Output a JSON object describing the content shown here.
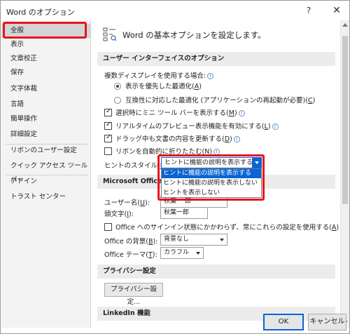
{
  "window": {
    "title": "Word のオプション",
    "help": "?",
    "close": "✕"
  },
  "sidebar": {
    "items": [
      {
        "label": "全般",
        "selected": true
      },
      {
        "label": "表示"
      },
      {
        "label": "文章校正"
      },
      {
        "label": "保存"
      },
      {
        "label": "文字体裁"
      },
      {
        "label": "言語"
      },
      {
        "label": "簡単操作"
      },
      {
        "label": "詳細設定"
      },
      {
        "label": "リボンのユーザー設定"
      },
      {
        "label": "クイック アクセス ツール バー"
      },
      {
        "label": "アドイン"
      },
      {
        "label": "トラスト センター"
      }
    ]
  },
  "header": {
    "text": "Word の基本オプションを設定します。"
  },
  "ui_section": {
    "title": "ユーザー インターフェイスのオプション",
    "multi_display_label": "複数ディスプレイを使用する場合:",
    "radio1": {
      "label": "表示を優先した最適化(",
      "key": "A",
      "close": ")"
    },
    "radio2": {
      "label": "互換性に対応した最適化 (アプリケーションの再起動が必要)(",
      "key": "C",
      "close": ")"
    },
    "cb1": {
      "label": "選択時にミニ ツール バーを表示する(",
      "key": "M",
      "close": ")",
      "checked": true
    },
    "cb2": {
      "label": "リアルタイムのプレビュー表示機能を有効にする(",
      "key": "L",
      "close": ")",
      "checked": true
    },
    "cb3": {
      "label": "ドラッグ中も文書の内容を更新する(",
      "key": "D",
      "close": ")",
      "checked": true
    },
    "cb4": {
      "label": "リボンを自動的に折りたたむ(",
      "key": "N",
      "close": ")",
      "checked": false
    },
    "tip_style_label": "ヒントのスタイル(",
    "tip_style_key": "R",
    "tip_style_close": "):",
    "tip_style_value": "ヒントに機能の説明を表示する",
    "tip_options": [
      "ヒントに機能の説明を表示する",
      "ヒントに機能の説明を表示しない",
      "ヒントを表示しない"
    ]
  },
  "office_section": {
    "title": "Microsoft Office の",
    "user_label": "ユーザー名(",
    "user_key": "U",
    "user_close": "):",
    "user_value": "秋葉 一郎",
    "initials_label": "頭文字(",
    "initials_key": "I",
    "initials_close": "):",
    "initials_value": "秋葉一郎",
    "always_label": "Office へのサインイン状態にかかわらず、常にこれらの設定を使用する(",
    "always_key": "A",
    "always_close": ")",
    "bg_label": "Office の背景(",
    "bg_key": "B",
    "bg_close": "):",
    "bg_value": "背景なし",
    "theme_label": "Office テーマ(",
    "theme_key": "T",
    "theme_close": "):",
    "theme_value": "カラフル"
  },
  "privacy_section": {
    "title": "プライバシー設定",
    "button": "プライバシー設定..."
  },
  "linkedin_section": {
    "title": "LinkedIn 機能"
  },
  "footer": {
    "ok": "OK",
    "cancel": "キャンセル"
  },
  "colors": {
    "accent": "#0a64d4",
    "highlight_red": "#e8141c"
  }
}
